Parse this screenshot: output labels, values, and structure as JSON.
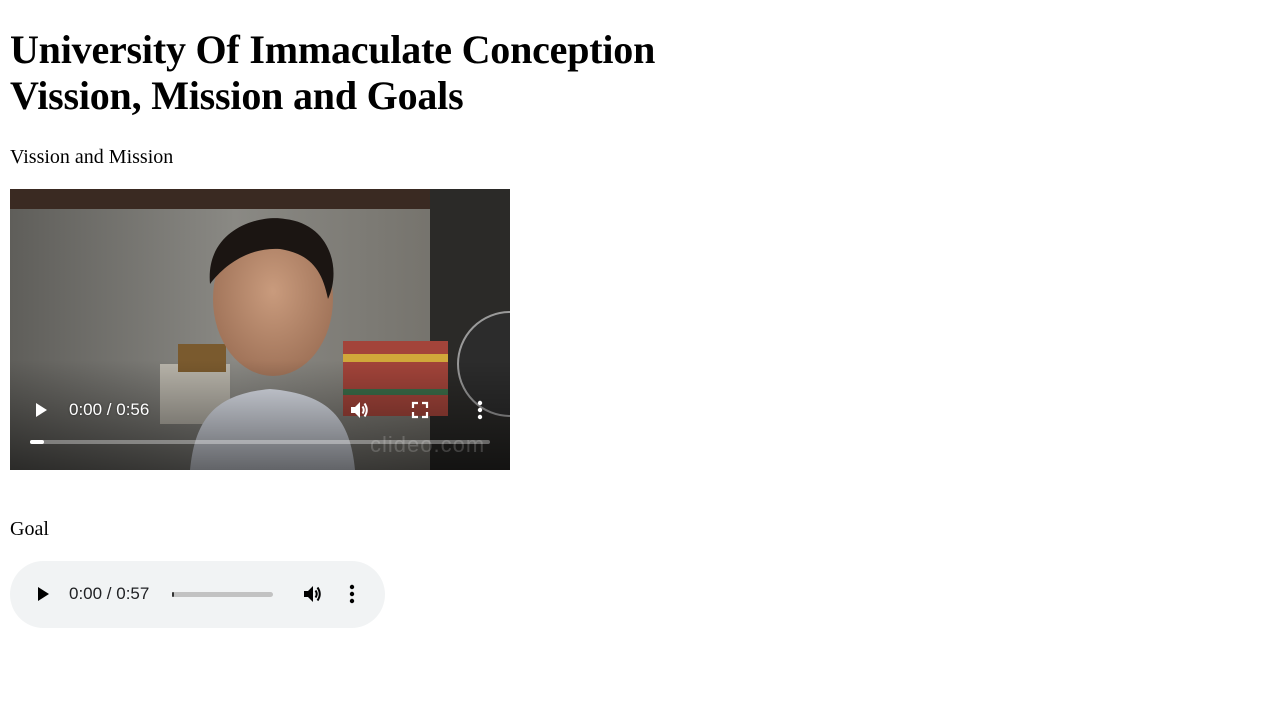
{
  "page": {
    "title_line1": "University Of Immaculate Conception",
    "title_line2": "Vission, Mission and Goals",
    "section_vm_label": "Vission and Mission",
    "section_goal_label": "Goal"
  },
  "video_player": {
    "time_display": "0:00 / 0:56",
    "progress": 0.03,
    "watermark": "clideo.com",
    "icons": [
      "play-icon",
      "volume-icon",
      "fullscreen-icon",
      "more-options-icon"
    ]
  },
  "audio_player": {
    "time_display": "0:00 / 0:57",
    "progress": 0.02,
    "icons": [
      "play-icon",
      "volume-icon",
      "more-options-icon"
    ]
  },
  "colors": {
    "audio_bg": "#f1f3f4",
    "text": "#000000"
  }
}
